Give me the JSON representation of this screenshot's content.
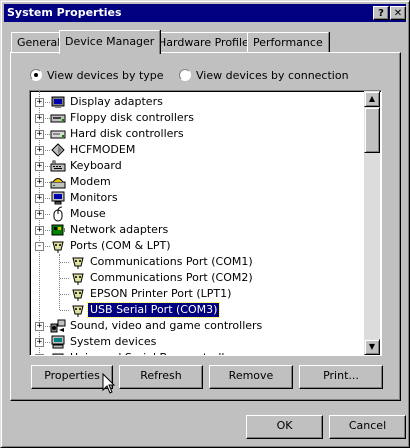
{
  "window": {
    "title": "System Properties",
    "help_label": "?",
    "close_label": "✕"
  },
  "tabs": [
    {
      "label": "General"
    },
    {
      "label": "Device Manager",
      "active": true
    },
    {
      "label": "Hardware Profiles"
    },
    {
      "label": "Performance"
    }
  ],
  "view_options": {
    "by_type": {
      "label": "View devices by type",
      "selected": true
    },
    "by_connection": {
      "label": "View devices by connection",
      "selected": false
    }
  },
  "device_tree": [
    {
      "label": "Display adapters",
      "icon": "display-adapter-icon",
      "expander": "+"
    },
    {
      "label": "Floppy disk controllers",
      "icon": "floppy-controller-icon",
      "expander": "+"
    },
    {
      "label": "Hard disk controllers",
      "icon": "hard-disk-controller-icon",
      "expander": "+"
    },
    {
      "label": "HCFMODEM",
      "icon": "hcf-modem-icon",
      "expander": "+"
    },
    {
      "label": "Keyboard",
      "icon": "keyboard-icon",
      "expander": "+"
    },
    {
      "label": "Modem",
      "icon": "modem-icon",
      "expander": "+"
    },
    {
      "label": "Monitors",
      "icon": "monitor-icon",
      "expander": "+"
    },
    {
      "label": "Mouse",
      "icon": "mouse-icon",
      "expander": "+"
    },
    {
      "label": "Network adapters",
      "icon": "network-adapter-icon",
      "expander": "+"
    },
    {
      "label": "Ports (COM & LPT)",
      "icon": "port-icon",
      "expander": "-"
    },
    {
      "label": "Communications Port (COM1)",
      "icon": "port-icon",
      "child": true
    },
    {
      "label": "Communications Port (COM2)",
      "icon": "port-icon",
      "child": true
    },
    {
      "label": "EPSON Printer Port (LPT1)",
      "icon": "port-icon",
      "child": true
    },
    {
      "label": "USB Serial Port (COM3)",
      "icon": "port-icon",
      "child": true,
      "selected": true
    },
    {
      "label": "Sound, video and game controllers",
      "icon": "sound-controller-icon",
      "expander": "+"
    },
    {
      "label": "System devices",
      "icon": "system-device-icon",
      "expander": "+"
    },
    {
      "label": "Universal Serial Bus controllers",
      "icon": "usb-controller-icon",
      "expander": "+"
    }
  ],
  "scrollbar": {
    "up_label": "▲",
    "down_label": "▼"
  },
  "actions": {
    "properties": "Properties",
    "refresh": "Refresh",
    "remove": "Remove",
    "print": "Print..."
  },
  "footer": {
    "ok": "OK",
    "cancel": "Cancel"
  },
  "colors": {
    "face": "#c0c0c0",
    "title_bar": "#000080",
    "selection": "#000080"
  }
}
